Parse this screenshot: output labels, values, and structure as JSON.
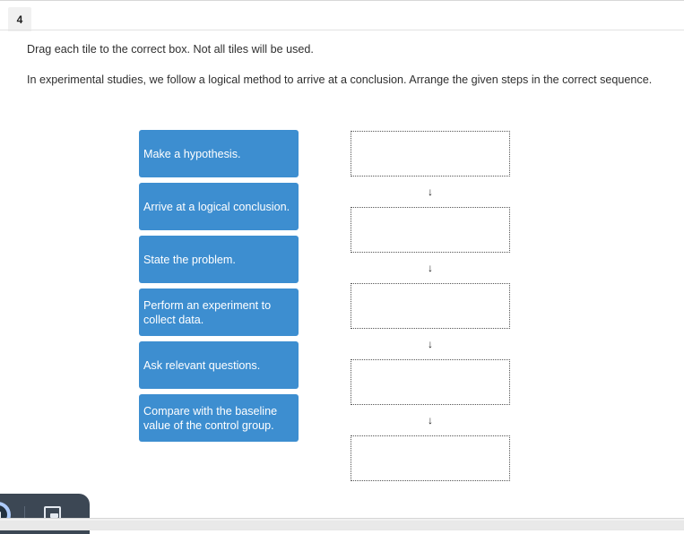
{
  "tab": {
    "label": "4"
  },
  "instructions": {
    "line1": "Drag each tile to the correct box. Not all tiles will be used.",
    "line2": "In experimental studies, we follow a logical method to arrive at a conclusion. Arrange the given steps in the correct sequence."
  },
  "tiles": [
    {
      "text": "Make a hypothesis."
    },
    {
      "text": "Arrive at a logical conclusion."
    },
    {
      "text": "State the problem."
    },
    {
      "text": "Perform an experiment to collect data."
    },
    {
      "text": "Ask relevant questions."
    },
    {
      "text": "Compare with the baseline value of the control group."
    }
  ],
  "drop_boxes": [
    {
      "value": ""
    },
    {
      "value": ""
    },
    {
      "value": ""
    },
    {
      "value": ""
    },
    {
      "value": ""
    }
  ],
  "flow_arrow": "↓",
  "media_bar": {
    "play_pause_state": "pause",
    "pip_label": "picture-in-picture"
  },
  "colors": {
    "tile_blue": "#3d8ed0",
    "tile_text": "#ffffff",
    "instruction_text": "#2f2f2f",
    "drop_border": "#555555",
    "media_panel": "#3c4754",
    "play_ring": "#aecbfa"
  }
}
